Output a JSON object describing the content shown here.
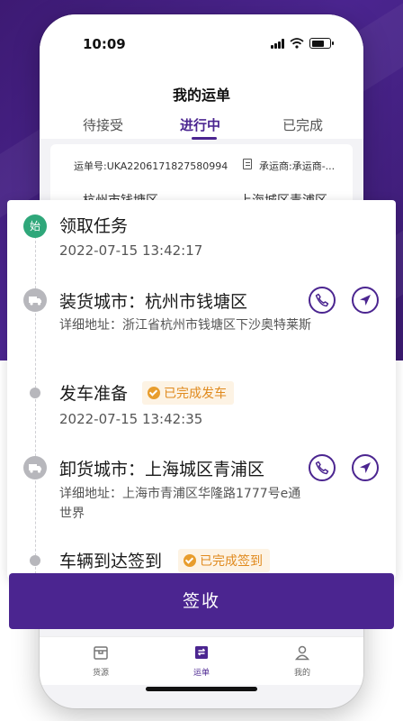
{
  "status_bar": {
    "time": "10:09"
  },
  "header": {
    "title": "我的运单",
    "tabs": [
      {
        "label": "待接受"
      },
      {
        "label": "进行中"
      },
      {
        "label": "已完成"
      }
    ],
    "active_tab": "进行中"
  },
  "order_card": {
    "order_no": "运单号:UKA2206171827580994",
    "carrier": "承运商:承运商-...",
    "from_peek": "杭州市钱塘区",
    "to_peek": "上海城区青浦区"
  },
  "timeline": {
    "start_node": "始",
    "steps": [
      {
        "title": "领取任务",
        "time": "2022-07-15 13:42:17"
      },
      {
        "title": "装货城市：杭州市钱塘区",
        "address": "详细地址：浙江省杭州市钱塘区下沙奥特莱斯"
      },
      {
        "title": "发车准备",
        "badge": "已完成发车",
        "time": "2022-07-15 13:42:35"
      },
      {
        "title": "卸货城市：上海城区青浦区",
        "address": "详细地址：上海市青浦区华隆路1777号e通世界"
      },
      {
        "title": "车辆到达签到",
        "badge": "已完成签到"
      }
    ]
  },
  "sign_button": "签收",
  "bottom_nav": [
    {
      "label": "货源",
      "icon": "box-icon"
    },
    {
      "label": "运单",
      "icon": "waybill-icon"
    },
    {
      "label": "我的",
      "icon": "person-icon"
    }
  ],
  "colors": {
    "primary": "#4b2590",
    "success": "#2fa77a",
    "badge_text": "#e08a1e",
    "badge_bg": "#fdf3e4"
  }
}
